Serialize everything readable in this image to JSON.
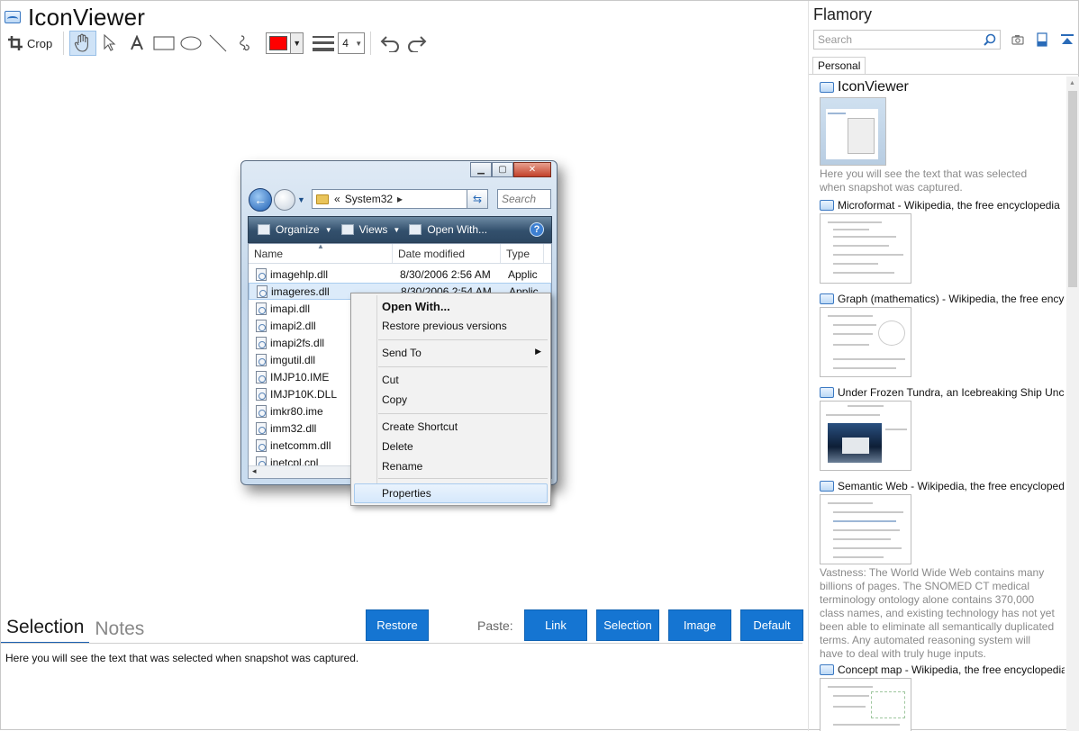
{
  "window": {
    "title": "IconViewer"
  },
  "toolbar": {
    "crop_label": "Crop",
    "stroke_width": "4",
    "color": "#ff0000"
  },
  "snapshot": {
    "explorer": {
      "address": "System32",
      "address_prefix": "«",
      "search_placeholder": "Search",
      "commands": [
        "Organize",
        "Views",
        "Open With..."
      ],
      "columns": [
        "Name",
        "Date modified",
        "Type"
      ],
      "rows": [
        {
          "name": "imagehlp.dll",
          "date": "8/30/2006 2:56 AM",
          "type": "Applic"
        },
        {
          "name": "imageres.dll",
          "date": "8/30/2006 2:54 AM",
          "type": "Applic"
        },
        {
          "name": "imapi.dll",
          "date": "",
          "type": ""
        },
        {
          "name": "imapi2.dll",
          "date": "",
          "type": ""
        },
        {
          "name": "imapi2fs.dll",
          "date": "",
          "type": ""
        },
        {
          "name": "imgutil.dll",
          "date": "",
          "type": ""
        },
        {
          "name": "IMJP10.IME",
          "date": "",
          "type": ""
        },
        {
          "name": "IMJP10K.DLL",
          "date": "",
          "type": ""
        },
        {
          "name": "imkr80.ime",
          "date": "",
          "type": ""
        },
        {
          "name": "imm32.dll",
          "date": "",
          "type": ""
        },
        {
          "name": "inetcomm.dll",
          "date": "",
          "type": ""
        },
        {
          "name": "inetcpl.cpl",
          "date": "",
          "type": ""
        }
      ]
    },
    "context_menu": {
      "open_with": "Open With...",
      "restore": "Restore previous versions",
      "send_to": "Send To",
      "cut": "Cut",
      "copy": "Copy",
      "create_shortcut": "Create Shortcut",
      "delete": "Delete",
      "rename": "Rename",
      "properties": "Properties"
    }
  },
  "bottom": {
    "tabs": [
      "Selection",
      "Notes"
    ],
    "restore_button": "Restore",
    "paste_label": "Paste:",
    "paste_buttons": [
      "Link",
      "Selection",
      "Image",
      "Default"
    ],
    "selection_text": "Here you will see the text that was selected when snapshot was captured."
  },
  "sidebar": {
    "title": "Flamory",
    "search_placeholder": "Search",
    "tab": "Personal",
    "entries": [
      {
        "title": "IconViewer",
        "desc": "Here you will see the text that was selected when snapshot was captured."
      },
      {
        "title": "Microformat - Wikipedia, the free encyclopedia",
        "desc": ""
      },
      {
        "title": "Graph (mathematics) - Wikipedia, the free encyclopedia",
        "desc": ""
      },
      {
        "title": "Under Frozen Tundra, an Icebreaking Ship Uncovers",
        "desc": ""
      },
      {
        "title": "Semantic Web - Wikipedia, the free encyclopedia",
        "desc": "Vastness: The World Wide Web contains many billions of pages. The SNOMED CT medical terminology ontology alone contains 370,000 class names, and existing technology has not yet been able to eliminate all semantically duplicated terms. Any automated reasoning system will have to deal with truly huge inputs."
      },
      {
        "title": "Concept map - Wikipedia, the free encyclopedia",
        "desc": ""
      }
    ]
  }
}
